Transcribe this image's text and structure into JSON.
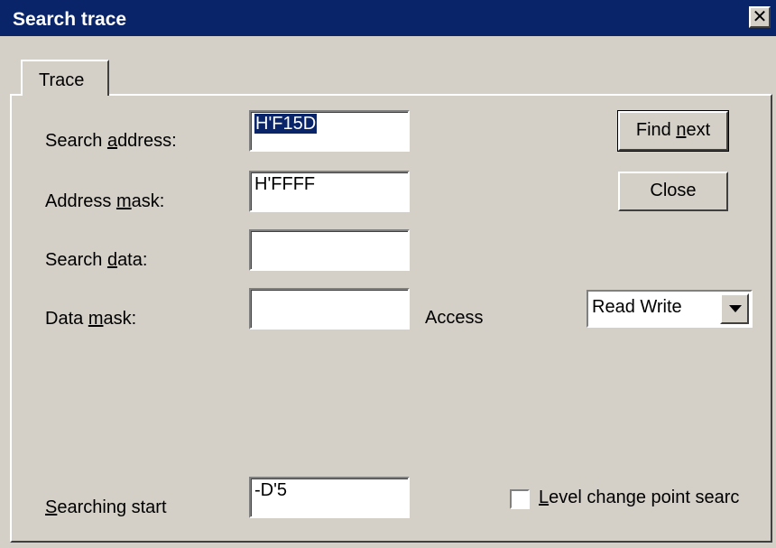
{
  "window": {
    "title": "Search trace",
    "close_glyph": "✕"
  },
  "tabs": [
    {
      "label": "Trace",
      "active": true
    }
  ],
  "fields": {
    "search_address": {
      "label_pre": "Search ",
      "label_u": "a",
      "label_post": "ddress:",
      "value": "H'F15D"
    },
    "address_mask": {
      "label_pre": "Address ",
      "label_u": "m",
      "label_post": "ask:",
      "value": "H'FFFF"
    },
    "search_data": {
      "label_pre": "Search ",
      "label_u": "d",
      "label_post": "ata:",
      "value": ""
    },
    "data_mask": {
      "label_pre": "Data ",
      "label_u": "m",
      "label_post": "ask:",
      "value": ""
    },
    "searching_start": {
      "label_pre": "",
      "label_u": "S",
      "label_post": "earching start",
      "value": "-D'5"
    }
  },
  "access": {
    "label": "Access",
    "selected": "Read Write"
  },
  "buttons": {
    "find_next_pre": "Find ",
    "find_next_u": "n",
    "find_next_post": "ext",
    "close": "Close"
  },
  "checkbox": {
    "label_u": "L",
    "label_post": "evel change point searc",
    "checked": false
  },
  "colors": {
    "titlebar": "#0a246a",
    "face": "#d4d0c8",
    "selection": "#0a246a"
  }
}
